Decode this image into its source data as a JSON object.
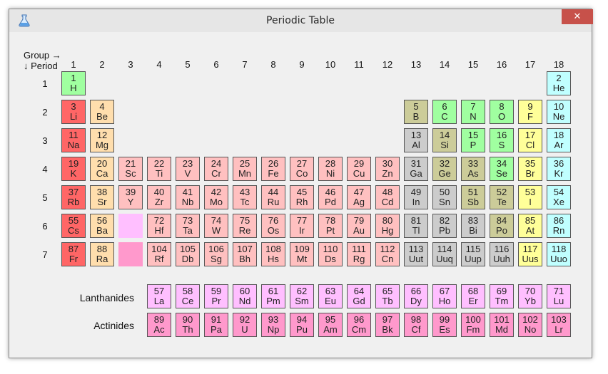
{
  "window": {
    "title": "Periodic Table",
    "close_glyph": "✕"
  },
  "axis": {
    "group": "Group →",
    "period": "↓ Period"
  },
  "groups": [
    "1",
    "2",
    "3",
    "4",
    "5",
    "6",
    "7",
    "8",
    "9",
    "10",
    "11",
    "12",
    "13",
    "14",
    "15",
    "16",
    "17",
    "18"
  ],
  "periods": [
    "1",
    "2",
    "3",
    "4",
    "5",
    "6",
    "7"
  ],
  "series_labels": {
    "lanthanides": "Lanthanides",
    "actinides": "Actinides"
  },
  "colors": {
    "alkali": "#ff6666",
    "alkaline": "#ffdead",
    "transition": "#ffc0c0",
    "poor": "#cccccc",
    "metalloid": "#cccc99",
    "nonmetal": "#a0ffa0",
    "halogen": "#ffff99",
    "noble": "#c0ffff",
    "lanthanide": "#ffbfff",
    "actinide": "#ff99cc"
  },
  "elements": [
    {
      "n": "1",
      "s": "H",
      "g": 1,
      "p": 1,
      "c": "nonmetal"
    },
    {
      "n": "2",
      "s": "He",
      "g": 18,
      "p": 1,
      "c": "noble"
    },
    {
      "n": "3",
      "s": "Li",
      "g": 1,
      "p": 2,
      "c": "alkali"
    },
    {
      "n": "4",
      "s": "Be",
      "g": 2,
      "p": 2,
      "c": "alkaline"
    },
    {
      "n": "5",
      "s": "B",
      "g": 13,
      "p": 2,
      "c": "metalloid"
    },
    {
      "n": "6",
      "s": "C",
      "g": 14,
      "p": 2,
      "c": "nonmetal"
    },
    {
      "n": "7",
      "s": "N",
      "g": 15,
      "p": 2,
      "c": "nonmetal"
    },
    {
      "n": "8",
      "s": "O",
      "g": 16,
      "p": 2,
      "c": "nonmetal"
    },
    {
      "n": "9",
      "s": "F",
      "g": 17,
      "p": 2,
      "c": "halogen"
    },
    {
      "n": "10",
      "s": "Ne",
      "g": 18,
      "p": 2,
      "c": "noble"
    },
    {
      "n": "11",
      "s": "Na",
      "g": 1,
      "p": 3,
      "c": "alkali"
    },
    {
      "n": "12",
      "s": "Mg",
      "g": 2,
      "p": 3,
      "c": "alkaline"
    },
    {
      "n": "13",
      "s": "Al",
      "g": 13,
      "p": 3,
      "c": "poor"
    },
    {
      "n": "14",
      "s": "Si",
      "g": 14,
      "p": 3,
      "c": "metalloid"
    },
    {
      "n": "15",
      "s": "P",
      "g": 15,
      "p": 3,
      "c": "nonmetal"
    },
    {
      "n": "16",
      "s": "S",
      "g": 16,
      "p": 3,
      "c": "nonmetal"
    },
    {
      "n": "17",
      "s": "Cl",
      "g": 17,
      "p": 3,
      "c": "halogen"
    },
    {
      "n": "18",
      "s": "Ar",
      "g": 18,
      "p": 3,
      "c": "noble"
    },
    {
      "n": "19",
      "s": "K",
      "g": 1,
      "p": 4,
      "c": "alkali"
    },
    {
      "n": "20",
      "s": "Ca",
      "g": 2,
      "p": 4,
      "c": "alkaline"
    },
    {
      "n": "21",
      "s": "Sc",
      "g": 3,
      "p": 4,
      "c": "transition"
    },
    {
      "n": "22",
      "s": "Ti",
      "g": 4,
      "p": 4,
      "c": "transition"
    },
    {
      "n": "23",
      "s": "V",
      "g": 5,
      "p": 4,
      "c": "transition"
    },
    {
      "n": "24",
      "s": "Cr",
      "g": 6,
      "p": 4,
      "c": "transition"
    },
    {
      "n": "25",
      "s": "Mn",
      "g": 7,
      "p": 4,
      "c": "transition"
    },
    {
      "n": "26",
      "s": "Fe",
      "g": 8,
      "p": 4,
      "c": "transition"
    },
    {
      "n": "27",
      "s": "Co",
      "g": 9,
      "p": 4,
      "c": "transition"
    },
    {
      "n": "28",
      "s": "Ni",
      "g": 10,
      "p": 4,
      "c": "transition"
    },
    {
      "n": "29",
      "s": "Cu",
      "g": 11,
      "p": 4,
      "c": "transition"
    },
    {
      "n": "30",
      "s": "Zn",
      "g": 12,
      "p": 4,
      "c": "transition"
    },
    {
      "n": "31",
      "s": "Ga",
      "g": 13,
      "p": 4,
      "c": "poor"
    },
    {
      "n": "32",
      "s": "Ge",
      "g": 14,
      "p": 4,
      "c": "metalloid"
    },
    {
      "n": "33",
      "s": "As",
      "g": 15,
      "p": 4,
      "c": "metalloid"
    },
    {
      "n": "34",
      "s": "Se",
      "g": 16,
      "p": 4,
      "c": "nonmetal"
    },
    {
      "n": "35",
      "s": "Br",
      "g": 17,
      "p": 4,
      "c": "halogen"
    },
    {
      "n": "36",
      "s": "Kr",
      "g": 18,
      "p": 4,
      "c": "noble"
    },
    {
      "n": "37",
      "s": "Rb",
      "g": 1,
      "p": 5,
      "c": "alkali"
    },
    {
      "n": "38",
      "s": "Sr",
      "g": 2,
      "p": 5,
      "c": "alkaline"
    },
    {
      "n": "39",
      "s": "Y",
      "g": 3,
      "p": 5,
      "c": "transition"
    },
    {
      "n": "40",
      "s": "Zr",
      "g": 4,
      "p": 5,
      "c": "transition"
    },
    {
      "n": "41",
      "s": "Nb",
      "g": 5,
      "p": 5,
      "c": "transition"
    },
    {
      "n": "42",
      "s": "Mo",
      "g": 6,
      "p": 5,
      "c": "transition"
    },
    {
      "n": "43",
      "s": "Tc",
      "g": 7,
      "p": 5,
      "c": "transition"
    },
    {
      "n": "44",
      "s": "Ru",
      "g": 8,
      "p": 5,
      "c": "transition"
    },
    {
      "n": "45",
      "s": "Rh",
      "g": 9,
      "p": 5,
      "c": "transition"
    },
    {
      "n": "46",
      "s": "Pd",
      "g": 10,
      "p": 5,
      "c": "transition"
    },
    {
      "n": "47",
      "s": "Ag",
      "g": 11,
      "p": 5,
      "c": "transition"
    },
    {
      "n": "48",
      "s": "Cd",
      "g": 12,
      "p": 5,
      "c": "transition"
    },
    {
      "n": "49",
      "s": "In",
      "g": 13,
      "p": 5,
      "c": "poor"
    },
    {
      "n": "50",
      "s": "Sn",
      "g": 14,
      "p": 5,
      "c": "poor"
    },
    {
      "n": "51",
      "s": "Sb",
      "g": 15,
      "p": 5,
      "c": "metalloid"
    },
    {
      "n": "52",
      "s": "Te",
      "g": 16,
      "p": 5,
      "c": "metalloid"
    },
    {
      "n": "53",
      "s": "I",
      "g": 17,
      "p": 5,
      "c": "halogen"
    },
    {
      "n": "54",
      "s": "Xe",
      "g": 18,
      "p": 5,
      "c": "noble"
    },
    {
      "n": "55",
      "s": "Cs",
      "g": 1,
      "p": 6,
      "c": "alkali"
    },
    {
      "n": "56",
      "s": "Ba",
      "g": 2,
      "p": 6,
      "c": "alkaline"
    },
    {
      "n": "72",
      "s": "Hf",
      "g": 4,
      "p": 6,
      "c": "transition"
    },
    {
      "n": "73",
      "s": "Ta",
      "g": 5,
      "p": 6,
      "c": "transition"
    },
    {
      "n": "74",
      "s": "W",
      "g": 6,
      "p": 6,
      "c": "transition"
    },
    {
      "n": "75",
      "s": "Re",
      "g": 7,
      "p": 6,
      "c": "transition"
    },
    {
      "n": "76",
      "s": "Os",
      "g": 8,
      "p": 6,
      "c": "transition"
    },
    {
      "n": "77",
      "s": "Ir",
      "g": 9,
      "p": 6,
      "c": "transition"
    },
    {
      "n": "78",
      "s": "Pt",
      "g": 10,
      "p": 6,
      "c": "transition"
    },
    {
      "n": "79",
      "s": "Au",
      "g": 11,
      "p": 6,
      "c": "transition"
    },
    {
      "n": "80",
      "s": "Hg",
      "g": 12,
      "p": 6,
      "c": "transition"
    },
    {
      "n": "81",
      "s": "Tl",
      "g": 13,
      "p": 6,
      "c": "poor"
    },
    {
      "n": "82",
      "s": "Pb",
      "g": 14,
      "p": 6,
      "c": "poor"
    },
    {
      "n": "83",
      "s": "Bi",
      "g": 15,
      "p": 6,
      "c": "poor"
    },
    {
      "n": "84",
      "s": "Po",
      "g": 16,
      "p": 6,
      "c": "metalloid"
    },
    {
      "n": "85",
      "s": "At",
      "g": 17,
      "p": 6,
      "c": "halogen"
    },
    {
      "n": "86",
      "s": "Rn",
      "g": 18,
      "p": 6,
      "c": "noble"
    },
    {
      "n": "87",
      "s": "Fr",
      "g": 1,
      "p": 7,
      "c": "alkali"
    },
    {
      "n": "88",
      "s": "Ra",
      "g": 2,
      "p": 7,
      "c": "alkaline"
    },
    {
      "n": "104",
      "s": "Rf",
      "g": 4,
      "p": 7,
      "c": "transition"
    },
    {
      "n": "105",
      "s": "Db",
      "g": 5,
      "p": 7,
      "c": "transition"
    },
    {
      "n": "106",
      "s": "Sg",
      "g": 6,
      "p": 7,
      "c": "transition"
    },
    {
      "n": "107",
      "s": "Bh",
      "g": 7,
      "p": 7,
      "c": "transition"
    },
    {
      "n": "108",
      "s": "Hs",
      "g": 8,
      "p": 7,
      "c": "transition"
    },
    {
      "n": "109",
      "s": "Mt",
      "g": 9,
      "p": 7,
      "c": "transition"
    },
    {
      "n": "110",
      "s": "Ds",
      "g": 10,
      "p": 7,
      "c": "transition"
    },
    {
      "n": "111",
      "s": "Rg",
      "g": 11,
      "p": 7,
      "c": "transition"
    },
    {
      "n": "112",
      "s": "Cn",
      "g": 12,
      "p": 7,
      "c": "transition"
    },
    {
      "n": "113",
      "s": "Uut",
      "g": 13,
      "p": 7,
      "c": "poor"
    },
    {
      "n": "114",
      "s": "Uuq",
      "g": 14,
      "p": 7,
      "c": "poor"
    },
    {
      "n": "115",
      "s": "Uup",
      "g": 15,
      "p": 7,
      "c": "poor"
    },
    {
      "n": "116",
      "s": "Uuh",
      "g": 16,
      "p": 7,
      "c": "poor"
    },
    {
      "n": "117",
      "s": "Uus",
      "g": 17,
      "p": 7,
      "c": "halogen"
    },
    {
      "n": "118",
      "s": "Uuo",
      "g": 18,
      "p": 7,
      "c": "noble"
    }
  ],
  "placeholders": [
    {
      "g": 3,
      "p": 6,
      "c": "lanthanide"
    },
    {
      "g": 3,
      "p": 7,
      "c": "actinide"
    }
  ],
  "lanthanides": [
    {
      "n": "57",
      "s": "La"
    },
    {
      "n": "58",
      "s": "Ce"
    },
    {
      "n": "59",
      "s": "Pr"
    },
    {
      "n": "60",
      "s": "Nd"
    },
    {
      "n": "61",
      "s": "Pm"
    },
    {
      "n": "62",
      "s": "Sm"
    },
    {
      "n": "63",
      "s": "Eu"
    },
    {
      "n": "64",
      "s": "Gd"
    },
    {
      "n": "65",
      "s": "Tb"
    },
    {
      "n": "66",
      "s": "Dy"
    },
    {
      "n": "67",
      "s": "Ho"
    },
    {
      "n": "68",
      "s": "Er"
    },
    {
      "n": "69",
      "s": "Tm"
    },
    {
      "n": "70",
      "s": "Yb"
    },
    {
      "n": "71",
      "s": "Lu"
    }
  ],
  "actinides": [
    {
      "n": "89",
      "s": "Ac"
    },
    {
      "n": "90",
      "s": "Th"
    },
    {
      "n": "91",
      "s": "Pa"
    },
    {
      "n": "92",
      "s": "U"
    },
    {
      "n": "93",
      "s": "Np"
    },
    {
      "n": "94",
      "s": "Pu"
    },
    {
      "n": "95",
      "s": "Am"
    },
    {
      "n": "96",
      "s": "Cm"
    },
    {
      "n": "97",
      "s": "Bk"
    },
    {
      "n": "98",
      "s": "Cf"
    },
    {
      "n": "99",
      "s": "Es"
    },
    {
      "n": "100",
      "s": "Fm"
    },
    {
      "n": "101",
      "s": "Md"
    },
    {
      "n": "102",
      "s": "No"
    },
    {
      "n": "103",
      "s": "Lr"
    }
  ]
}
